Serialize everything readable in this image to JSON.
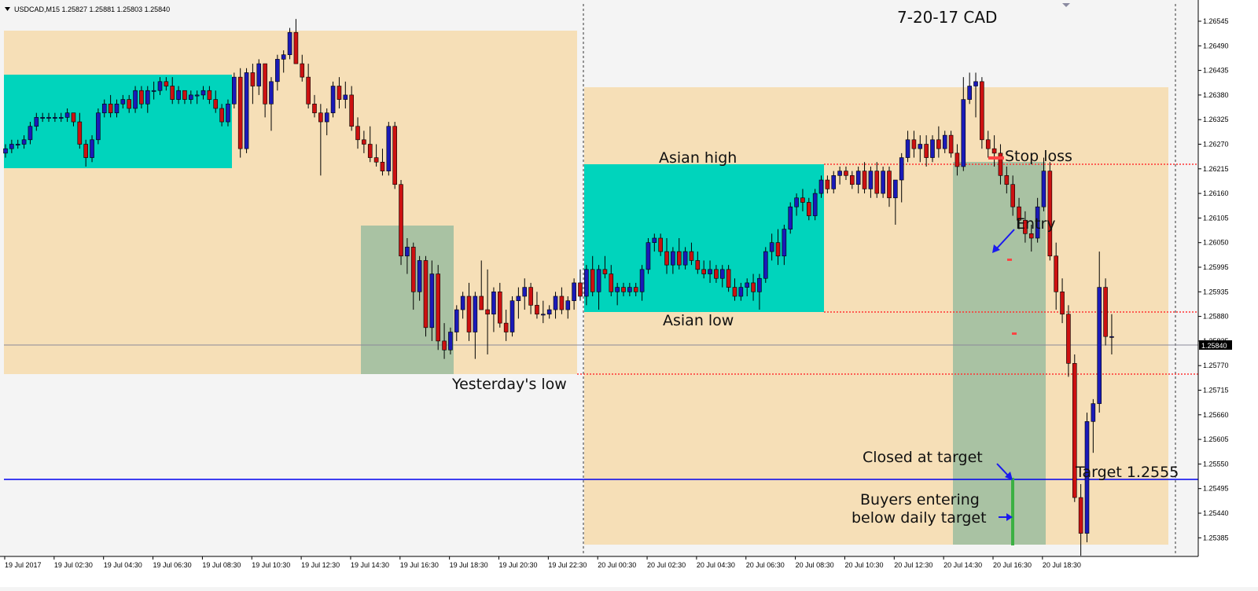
{
  "header": {
    "symbol_info": "USDCAD,M15  1.25827 1.25881 1.25803 1.25840",
    "chart_title": "7-20-17  CAD"
  },
  "annotations": {
    "asian_high": "Asian high",
    "asian_low": "Asian low",
    "stop_loss": "Stop loss",
    "entry": "Entry",
    "yesterdays_low": "Yesterday's low",
    "closed_at_target": "Closed at target",
    "target": "Target  1.2555",
    "buyers_line1": "Buyers entering",
    "buyers_line2": "below daily target"
  },
  "colors": {
    "background": "#f4f4f4",
    "session_box": "#f6dfb7",
    "asian_box": "#00d4bc",
    "trade_box": "#a9c2a3",
    "bull_candle": "#1a1ab8",
    "bear_candle": "#cc1111",
    "target_line": "#0000ee",
    "level_line": "#ff3333"
  },
  "chart_data": {
    "type": "candlestick",
    "title": "7-20-17  CAD",
    "symbol": "USDCAD",
    "timeframe": "M15",
    "ylim": [
      1.2536,
      1.2658
    ],
    "y_ticks": [
      "1.26545",
      "1.26490",
      "1.26435",
      "1.26380",
      "1.26325",
      "1.26270",
      "1.26215",
      "1.26160",
      "1.26105",
      "1.26050",
      "1.25995",
      "1.25935",
      "1.25880",
      "1.25825",
      "1.25770",
      "1.25715",
      "1.25660",
      "1.25605",
      "1.25550",
      "1.25495",
      "1.25440",
      "1.25385"
    ],
    "x_ticks": [
      "19 Jul 2017",
      "19 Jul 02:30",
      "19 Jul 04:30",
      "19 Jul 06:30",
      "19 Jul 08:30",
      "19 Jul 10:30",
      "19 Jul 12:30",
      "19 Jul 14:30",
      "19 Jul 16:30",
      "19 Jul 18:30",
      "19 Jul 20:30",
      "19 Jul 22:30",
      "20 Jul 00:30",
      "20 Jul 02:30",
      "20 Jul 04:30",
      "20 Jul 06:30",
      "20 Jul 08:30",
      "20 Jul 10:30",
      "20 Jul 12:30",
      "20 Jul 14:30",
      "20 Jul 16:30",
      "20 Jul 18:30"
    ],
    "current_price": "1.25840",
    "target_price": 1.2555,
    "levels": {
      "asian_high": 1.2623,
      "asian_low": 1.2592,
      "yesterdays_low": 1.2578
    },
    "bars_ohlc": [
      [
        1.2625,
        1.2627,
        1.2624,
        1.2626
      ],
      [
        1.2626,
        1.2628,
        1.2625,
        1.2627
      ],
      [
        1.2627,
        1.2628,
        1.2626,
        1.2627
      ],
      [
        1.2627,
        1.2629,
        1.2626,
        1.2628
      ],
      [
        1.2628,
        1.2632,
        1.2627,
        1.2631
      ],
      [
        1.2631,
        1.2634,
        1.263,
        1.2633
      ],
      [
        1.2633,
        1.2634,
        1.2632,
        1.2633
      ],
      [
        1.2633,
        1.2634,
        1.2632,
        1.2633
      ],
      [
        1.2633,
        1.2634,
        1.2632,
        1.2633
      ],
      [
        1.2633,
        1.2634,
        1.2632,
        1.2633
      ],
      [
        1.2633,
        1.2635,
        1.2632,
        1.2634
      ],
      [
        1.2634,
        1.2634,
        1.2631,
        1.2632
      ],
      [
        1.2632,
        1.2634,
        1.2626,
        1.2627
      ],
      [
        1.2627,
        1.2628,
        1.2622,
        1.2624
      ],
      [
        1.2624,
        1.2629,
        1.2623,
        1.2628
      ],
      [
        1.2628,
        1.2635,
        1.2627,
        1.2634
      ],
      [
        1.2634,
        1.2637,
        1.2633,
        1.2636
      ],
      [
        1.2636,
        1.2638,
        1.2633,
        1.2634
      ],
      [
        1.2634,
        1.2637,
        1.2633,
        1.2636
      ],
      [
        1.2636,
        1.2638,
        1.2635,
        1.2637
      ],
      [
        1.2637,
        1.2638,
        1.2634,
        1.2635
      ],
      [
        1.2635,
        1.264,
        1.2634,
        1.2639
      ],
      [
        1.2639,
        1.264,
        1.2635,
        1.2636
      ],
      [
        1.2636,
        1.264,
        1.2634,
        1.2639
      ],
      [
        1.2639,
        1.2641,
        1.2637,
        1.2639
      ],
      [
        1.2639,
        1.2642,
        1.2638,
        1.2641
      ],
      [
        1.2641,
        1.2642,
        1.2639,
        1.264
      ],
      [
        1.264,
        1.2642,
        1.2636,
        1.2637
      ],
      [
        1.2637,
        1.264,
        1.2636,
        1.2639
      ],
      [
        1.2639,
        1.2639,
        1.2636,
        1.2637
      ],
      [
        1.2637,
        1.2639,
        1.2636,
        1.2638
      ],
      [
        1.2638,
        1.2639,
        1.2636,
        1.2638
      ],
      [
        1.2638,
        1.264,
        1.2637,
        1.2639
      ],
      [
        1.2639,
        1.264,
        1.2636,
        1.2637
      ],
      [
        1.2637,
        1.2639,
        1.2634,
        1.2635
      ],
      [
        1.2635,
        1.2636,
        1.2631,
        1.2632
      ],
      [
        1.2632,
        1.2637,
        1.2631,
        1.2636
      ],
      [
        1.2636,
        1.2643,
        1.2635,
        1.2642
      ],
      [
        1.2642,
        1.2644,
        1.2624,
        1.2626
      ],
      [
        1.2626,
        1.2644,
        1.2625,
        1.2643
      ],
      [
        1.2643,
        1.2645,
        1.2636,
        1.264
      ],
      [
        1.264,
        1.2646,
        1.2638,
        1.2645
      ],
      [
        1.2645,
        1.2645,
        1.2633,
        1.2636
      ],
      [
        1.2636,
        1.2642,
        1.263,
        1.2641
      ],
      [
        1.2641,
        1.2647,
        1.2639,
        1.2646
      ],
      [
        1.2646,
        1.2648,
        1.2643,
        1.2647
      ],
      [
        1.2647,
        1.2653,
        1.2646,
        1.2652
      ],
      [
        1.2652,
        1.2655,
        1.2645,
        1.2645
      ],
      [
        1.2645,
        1.2647,
        1.2641,
        1.2642
      ],
      [
        1.2642,
        1.2645,
        1.2635,
        1.2636
      ],
      [
        1.2636,
        1.2638,
        1.2633,
        1.2634
      ],
      [
        1.2634,
        1.2636,
        1.262,
        1.2632
      ],
      [
        1.2632,
        1.2635,
        1.2629,
        1.2634
      ],
      [
        1.2634,
        1.2641,
        1.2633,
        1.264
      ],
      [
        1.264,
        1.2642,
        1.2635,
        1.2637
      ],
      [
        1.2637,
        1.2641,
        1.2635,
        1.2638
      ],
      [
        1.2638,
        1.264,
        1.263,
        1.2631
      ],
      [
        1.2631,
        1.2633,
        1.2626,
        1.2628
      ],
      [
        1.2628,
        1.263,
        1.2625,
        1.2627
      ],
      [
        1.2627,
        1.2631,
        1.2623,
        1.2624
      ],
      [
        1.2624,
        1.2627,
        1.2622,
        1.2623
      ],
      [
        1.2623,
        1.2626,
        1.262,
        1.2621
      ],
      [
        1.2621,
        1.2632,
        1.262,
        1.2631
      ],
      [
        1.2631,
        1.2632,
        1.2617,
        1.2618
      ],
      [
        1.2618,
        1.2619,
        1.26,
        1.2602
      ],
      [
        1.2602,
        1.2606,
        1.2598,
        1.2604
      ],
      [
        1.2604,
        1.2605,
        1.259,
        1.2594
      ],
      [
        1.2594,
        1.2602,
        1.2592,
        1.2601
      ],
      [
        1.2601,
        1.2602,
        1.2584,
        1.2586
      ],
      [
        1.2586,
        1.2601,
        1.2583,
        1.2598
      ],
      [
        1.2598,
        1.26,
        1.2581,
        1.2583
      ],
      [
        1.2583,
        1.2587,
        1.2579,
        1.2581
      ],
      [
        1.2581,
        1.2586,
        1.258,
        1.2585
      ],
      [
        1.2585,
        1.2591,
        1.2583,
        1.259
      ],
      [
        1.259,
        1.2594,
        1.2588,
        1.2593
      ],
      [
        1.2593,
        1.2596,
        1.2583,
        1.2585
      ],
      [
        1.2585,
        1.2594,
        1.2579,
        1.2593
      ],
      [
        1.2593,
        1.2601,
        1.259,
        1.259
      ],
      [
        1.259,
        1.2599,
        1.258,
        1.2589
      ],
      [
        1.2589,
        1.2595,
        1.2585,
        1.2594
      ],
      [
        1.2594,
        1.2596,
        1.2586,
        1.2587
      ],
      [
        1.2587,
        1.259,
        1.2583,
        1.2585
      ],
      [
        1.2585,
        1.2593,
        1.2584,
        1.2592
      ],
      [
        1.2592,
        1.2595,
        1.2588,
        1.2593
      ],
      [
        1.2593,
        1.2597,
        1.259,
        1.2595
      ],
      [
        1.2595,
        1.2596,
        1.2589,
        1.2591
      ],
      [
        1.2591,
        1.2594,
        1.2588,
        1.2589
      ],
      [
        1.2589,
        1.2592,
        1.2587,
        1.2589
      ],
      [
        1.2589,
        1.2591,
        1.2588,
        1.259
      ],
      [
        1.259,
        1.2594,
        1.2588,
        1.2593
      ],
      [
        1.2593,
        1.2595,
        1.2589,
        1.259
      ],
      [
        1.259,
        1.2593,
        1.2588,
        1.2592
      ],
      [
        1.2592,
        1.2597,
        1.259,
        1.2596
      ],
      [
        1.2596,
        1.2599,
        1.2592,
        1.2593
      ],
      [
        1.2593,
        1.26,
        1.2591,
        1.2599
      ],
      [
        1.2599,
        1.2602,
        1.2593,
        1.2594
      ],
      [
        1.2594,
        1.26,
        1.259,
        1.2599
      ],
      [
        1.2599,
        1.2602,
        1.2597,
        1.2598
      ],
      [
        1.2598,
        1.26,
        1.2593,
        1.2594
      ],
      [
        1.2594,
        1.2596,
        1.2591,
        1.2595
      ],
      [
        1.2595,
        1.2596,
        1.2593,
        1.2594
      ],
      [
        1.2594,
        1.2596,
        1.2593,
        1.2595
      ],
      [
        1.2595,
        1.2596,
        1.2593,
        1.2594
      ],
      [
        1.2594,
        1.26,
        1.2592,
        1.2599
      ],
      [
        1.2599,
        1.2606,
        1.2598,
        1.2605
      ],
      [
        1.2605,
        1.2607,
        1.2603,
        1.2606
      ],
      [
        1.2606,
        1.2607,
        1.2602,
        1.2603
      ],
      [
        1.2603,
        1.2606,
        1.2598,
        1.26
      ],
      [
        1.26,
        1.2604,
        1.2598,
        1.2603
      ],
      [
        1.2603,
        1.2606,
        1.2599,
        1.26
      ],
      [
        1.26,
        1.2604,
        1.2599,
        1.2603
      ],
      [
        1.2603,
        1.2605,
        1.26,
        1.2601
      ],
      [
        1.2601,
        1.2603,
        1.2598,
        1.2599
      ],
      [
        1.2599,
        1.2601,
        1.2597,
        1.2598
      ],
      [
        1.2598,
        1.2601,
        1.2596,
        1.2599
      ],
      [
        1.2599,
        1.26,
        1.2596,
        1.2597
      ],
      [
        1.2597,
        1.26,
        1.2595,
        1.2599
      ],
      [
        1.2599,
        1.26,
        1.2594,
        1.2595
      ],
      [
        1.2595,
        1.2597,
        1.2592,
        1.2593
      ],
      [
        1.2593,
        1.2596,
        1.2592,
        1.2595
      ],
      [
        1.2595,
        1.2597,
        1.2593,
        1.2596
      ],
      [
        1.2596,
        1.2598,
        1.2592,
        1.2594
      ],
      [
        1.2594,
        1.2598,
        1.259,
        1.2597
      ],
      [
        1.2597,
        1.2604,
        1.2596,
        1.2603
      ],
      [
        1.2603,
        1.2607,
        1.2601,
        1.2605
      ],
      [
        1.2605,
        1.2608,
        1.26,
        1.2602
      ],
      [
        1.2602,
        1.2609,
        1.26,
        1.2608
      ],
      [
        1.2608,
        1.2614,
        1.2607,
        1.2613
      ],
      [
        1.2613,
        1.2616,
        1.2611,
        1.2615
      ],
      [
        1.2615,
        1.2617,
        1.2612,
        1.2614
      ],
      [
        1.2614,
        1.2615,
        1.261,
        1.2611
      ],
      [
        1.2611,
        1.2617,
        1.261,
        1.2616
      ],
      [
        1.2616,
        1.262,
        1.2615,
        1.2619
      ],
      [
        1.2619,
        1.262,
        1.2616,
        1.2617
      ],
      [
        1.2617,
        1.2621,
        1.2616,
        1.262
      ],
      [
        1.262,
        1.2622,
        1.2618,
        1.2621
      ],
      [
        1.2621,
        1.2622,
        1.2619,
        1.262
      ],
      [
        1.262,
        1.2621,
        1.2617,
        1.2618
      ],
      [
        1.2618,
        1.2622,
        1.2616,
        1.2621
      ],
      [
        1.2621,
        1.2623,
        1.2616,
        1.2617
      ],
      [
        1.2617,
        1.2622,
        1.2615,
        1.2621
      ],
      [
        1.2621,
        1.2623,
        1.2615,
        1.2616
      ],
      [
        1.2616,
        1.2622,
        1.2615,
        1.2621
      ],
      [
        1.2621,
        1.2622,
        1.2613,
        1.2615
      ],
      [
        1.2615,
        1.2618,
        1.2609,
        1.2619
      ],
      [
        1.2619,
        1.2625,
        1.2614,
        1.2624
      ],
      [
        1.2624,
        1.263,
        1.2623,
        1.2628
      ],
      [
        1.2628,
        1.263,
        1.2624,
        1.2626
      ],
      [
        1.2626,
        1.2629,
        1.2623,
        1.2627
      ],
      [
        1.2627,
        1.2629,
        1.2622,
        1.2624
      ],
      [
        1.2624,
        1.2629,
        1.2623,
        1.2628
      ],
      [
        1.2628,
        1.2631,
        1.2624,
        1.2626
      ],
      [
        1.2626,
        1.263,
        1.2625,
        1.2629
      ],
      [
        1.2629,
        1.263,
        1.2624,
        1.2625
      ],
      [
        1.2625,
        1.2627,
        1.262,
        1.2622
      ],
      [
        1.2622,
        1.2642,
        1.2621,
        1.2637
      ],
      [
        1.2637,
        1.2643,
        1.2636,
        1.264
      ],
      [
        1.264,
        1.2643,
        1.2633,
        1.2641
      ],
      [
        1.2641,
        1.2642,
        1.2626,
        1.2628
      ],
      [
        1.2628,
        1.263,
        1.2624,
        1.2626
      ],
      [
        1.2626,
        1.2629,
        1.2622,
        1.2625
      ],
      [
        1.2625,
        1.2627,
        1.2618,
        1.262
      ],
      [
        1.262,
        1.2622,
        1.2616,
        1.2618
      ],
      [
        1.2618,
        1.262,
        1.2611,
        1.2613
      ],
      [
        1.2613,
        1.2615,
        1.2608,
        1.261
      ],
      [
        1.261,
        1.2612,
        1.2605,
        1.2607
      ],
      [
        1.2607,
        1.2609,
        1.2603,
        1.2606
      ],
      [
        1.2606,
        1.2615,
        1.2605,
        1.2613
      ],
      [
        1.2613,
        1.2624,
        1.2612,
        1.2621
      ],
      [
        1.2621,
        1.2623,
        1.2601,
        1.2602
      ],
      [
        1.2602,
        1.2605,
        1.259,
        1.2594
      ],
      [
        1.2594,
        1.2597,
        1.2587,
        1.2589
      ],
      [
        1.2589,
        1.2591,
        1.2575,
        1.2578
      ],
      [
        1.2578,
        1.258,
        1.2547,
        1.2548
      ],
      [
        1.2548,
        1.2551,
        1.2535,
        1.254
      ],
      [
        1.254,
        1.2567,
        1.2538,
        1.2565
      ],
      [
        1.2565,
        1.257,
        1.2558,
        1.2569
      ],
      [
        1.2569,
        1.2603,
        1.2567,
        1.2595
      ],
      [
        1.2595,
        1.2597,
        1.2582,
        1.2584
      ],
      [
        1.2584,
        1.2589,
        1.258,
        1.2584
      ]
    ]
  }
}
